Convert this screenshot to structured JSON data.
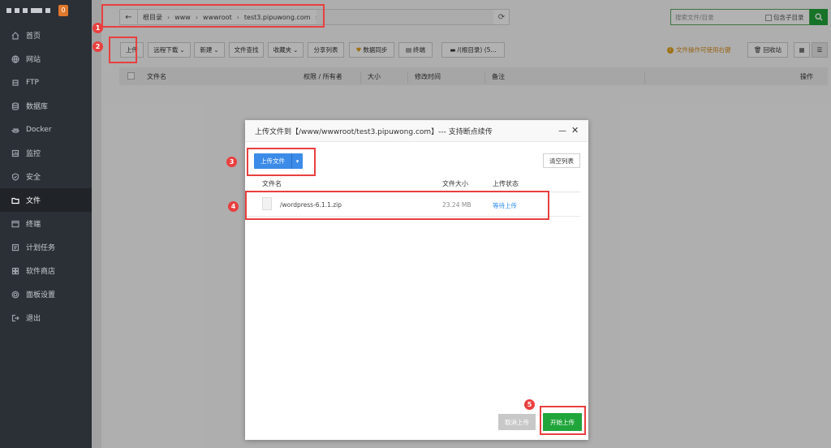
{
  "sidebar": {
    "badge": "0",
    "items": [
      {
        "label": "首页",
        "icon": "home-icon"
      },
      {
        "label": "网站",
        "icon": "globe-icon"
      },
      {
        "label": "FTP",
        "icon": "ftp-icon"
      },
      {
        "label": "数据库",
        "icon": "database-icon"
      },
      {
        "label": "Docker",
        "icon": "docker-icon"
      },
      {
        "label": "监控",
        "icon": "monitor-icon"
      },
      {
        "label": "安全",
        "icon": "shield-icon"
      },
      {
        "label": "文件",
        "icon": "folder-icon",
        "active": true
      },
      {
        "label": "终端",
        "icon": "terminal-icon"
      },
      {
        "label": "计划任务",
        "icon": "clock-icon"
      },
      {
        "label": "软件商店",
        "icon": "grid-icon"
      },
      {
        "label": "面板设置",
        "icon": "gear-icon"
      },
      {
        "label": "退出",
        "icon": "logout-icon"
      }
    ]
  },
  "pathbar": {
    "back": "←",
    "crumbs": [
      "根目录",
      "www",
      "wwwroot",
      "test3.pipuwong.com"
    ],
    "refresh": "⟳"
  },
  "search": {
    "placeholder": "搜索文件/目录",
    "include_sub": "包含子目录"
  },
  "toolbar": {
    "upload": "上传",
    "remote_download": "远程下载",
    "new": "新建",
    "find": "文件查找",
    "favorites": "收藏夹",
    "share_list": "分享列表",
    "sync": "数据同步",
    "terminal": "终端",
    "disk": "/(根目录) (5...",
    "tip": "文件操作可使用右键",
    "recycle": "回收站"
  },
  "table": {
    "headers": [
      "文件名",
      "权限 / 所有者",
      "大小",
      "修改时间",
      "备注",
      "操作"
    ]
  },
  "dialog": {
    "title": "上传文件到【/www/wwwroot/test3.pipuwong.com】--- 支持断点续传",
    "upload_file": "上传文件",
    "clear_list": "清空列表",
    "headers": [
      "文件名",
      "文件大小",
      "上传状态"
    ],
    "files": [
      {
        "name": "/wordpress-6.1.1.zip",
        "size": "23.24 MB",
        "status": "等待上传"
      }
    ],
    "cancel": "取消上传",
    "start": "开始上传"
  },
  "annotations": [
    "1",
    "2",
    "3",
    "4",
    "5"
  ],
  "colors": {
    "accent_green": "#20a53a",
    "upload_blue": "#3c8be8",
    "annotation_red": "#e8403f",
    "sidebar_bg": "#2b2f36"
  }
}
